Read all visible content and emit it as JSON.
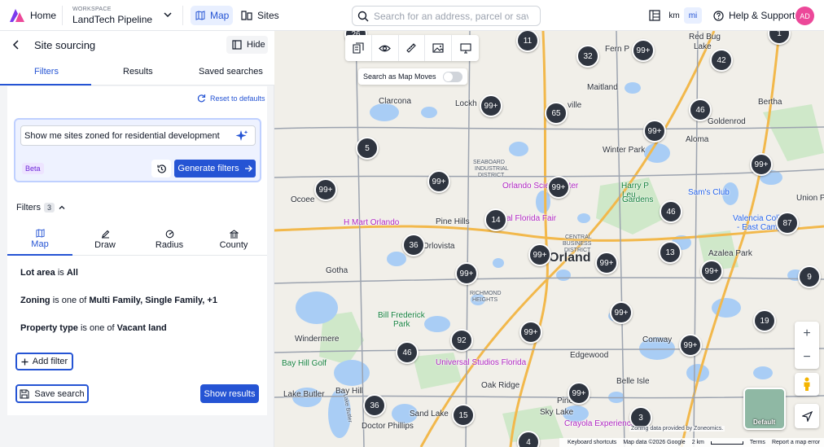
{
  "header": {
    "home_label": "Home",
    "workspace_caption": "WORKSPACE",
    "workspace_name": "LandTech Pipeline",
    "map_tab": "Map",
    "sites_tab": "Sites",
    "search_placeholder": "Search for an address, parcel or saved s",
    "unit_km": "km",
    "unit_mi": "mi",
    "help_label": "Help & Support",
    "avatar_initials": "AD",
    "accent_color": "#2554d4"
  },
  "panel": {
    "title": "Site sourcing",
    "hide_label": "Hide",
    "tabs": [
      "Filters",
      "Results",
      "Saved searches"
    ],
    "reset_label": "Reset to defaults",
    "ai_prompt": "Show me sites zoned for residential development",
    "beta_label": "Beta",
    "generate_label": "Generate filters",
    "filters_label": "Filters",
    "filters_count": "3",
    "filter_tabs": [
      "Map",
      "Draw",
      "Radius",
      "County"
    ],
    "conditions": [
      {
        "field": "Lot area",
        "op": " is ",
        "value": "All"
      },
      {
        "field": "Zoning",
        "op": " is one of ",
        "value": "Multi Family, Single Family, +1"
      },
      {
        "field": "Property type",
        "op": " is one of ",
        "value": "Vacant land"
      }
    ],
    "add_filter_label": "Add filter",
    "save_search_label": "Save search",
    "show_results_label": "Show results"
  },
  "map": {
    "search_as_moves_label": "Search as Map Moves",
    "search_as_moves_on": false,
    "default_label": "Default",
    "zoning_credit": "Zoning data provided by Zoneomics.",
    "attribution": [
      "Keyboard shortcuts",
      "Map data ©2026 Google",
      "2 km",
      "Terms",
      "Report a map error"
    ],
    "places": [
      {
        "t": "Fern P",
        "c": ""
      },
      {
        "t": "Red Bug",
        "c": ""
      },
      {
        "t": "Lake",
        "c": ""
      },
      {
        "t": "Maitland",
        "c": ""
      },
      {
        "t": "Clarcona",
        "c": ""
      },
      {
        "t": "Lockh",
        "c": ""
      },
      {
        "t": "ville",
        "c": ""
      },
      {
        "t": "Bertha",
        "c": ""
      },
      {
        "t": "Goldenrod",
        "c": ""
      },
      {
        "t": "Winter Park",
        "c": ""
      },
      {
        "t": "Aloma",
        "c": ""
      },
      {
        "t": "Ocoee",
        "c": ""
      },
      {
        "t": "Orlando Scie",
        "c": "poi"
      },
      {
        "t": "nter",
        "c": "poi"
      },
      {
        "t": "Harry P",
        "c": "green"
      },
      {
        "t": "Leu",
        "c": "green"
      },
      {
        "t": "Gardens",
        "c": "green"
      },
      {
        "t": "Sam's Club",
        "c": "blue"
      },
      {
        "t": "Union P",
        "c": ""
      },
      {
        "t": "H Mart Orlando",
        "c": "poi"
      },
      {
        "t": "Pine Hills",
        "c": ""
      },
      {
        "t": "al Florida Fair",
        "c": "poi"
      },
      {
        "t": "Valencia Colle",
        "c": "blue"
      },
      {
        "t": "- East Camp",
        "c": "blue"
      },
      {
        "t": "Orlovista",
        "c": ""
      },
      {
        "t": "Orland",
        "c": "big"
      },
      {
        "t": "Azalea Park",
        "c": ""
      },
      {
        "t": "Gotha",
        "c": ""
      },
      {
        "t": "Windermere",
        "c": ""
      },
      {
        "t": "Bill Frederick",
        "c": "green"
      },
      {
        "t": "Park",
        "c": "green"
      },
      {
        "t": "Conway",
        "c": ""
      },
      {
        "t": "Universal Studios Florida",
        "c": "poi"
      },
      {
        "t": "Edgewood",
        "c": ""
      },
      {
        "t": "Bay Hill",
        "c": ""
      },
      {
        "t": "Oak Ridge",
        "c": ""
      },
      {
        "t": "Belle Isle",
        "c": ""
      },
      {
        "t": "Lake Butler",
        "c": ""
      },
      {
        "t": "Sky Lake",
        "c": ""
      },
      {
        "t": "Doctor Phillips",
        "c": ""
      },
      {
        "t": "Sand Lake",
        "c": ""
      },
      {
        "t": "Crayola Experience",
        "c": "poi"
      },
      {
        "t": "Bay Hill Golf",
        "c": "green"
      },
      {
        "t": "SEABOARD",
        "c": "small"
      },
      {
        "t": "INDUSTRIAL",
        "c": "small"
      },
      {
        "t": "DISTRICT",
        "c": "small"
      },
      {
        "t": "CENTRAL",
        "c": "small"
      },
      {
        "t": "BUSINESS",
        "c": "small"
      },
      {
        "t": "DISTRICT",
        "c": "small"
      },
      {
        "t": "RICHMOND",
        "c": "small"
      },
      {
        "t": "HEIGHTS",
        "c": "small"
      },
      {
        "t": "Pine",
        "c": ""
      },
      {
        "t": "Lake Butler",
        "c": "small"
      }
    ],
    "clusters": [
      "11",
      "32",
      "99+",
      "42",
      "1",
      "99+",
      "65",
      "46",
      "5",
      "99+",
      "99+",
      "99+",
      "99+",
      "99+",
      "46",
      "14",
      "87",
      "36",
      "13",
      "99+",
      "99+",
      "99+",
      "99+",
      "9",
      "99+",
      "19",
      "92",
      "99+",
      "46",
      "99+",
      "99+",
      "36",
      "15",
      "3",
      "4",
      "26"
    ]
  }
}
